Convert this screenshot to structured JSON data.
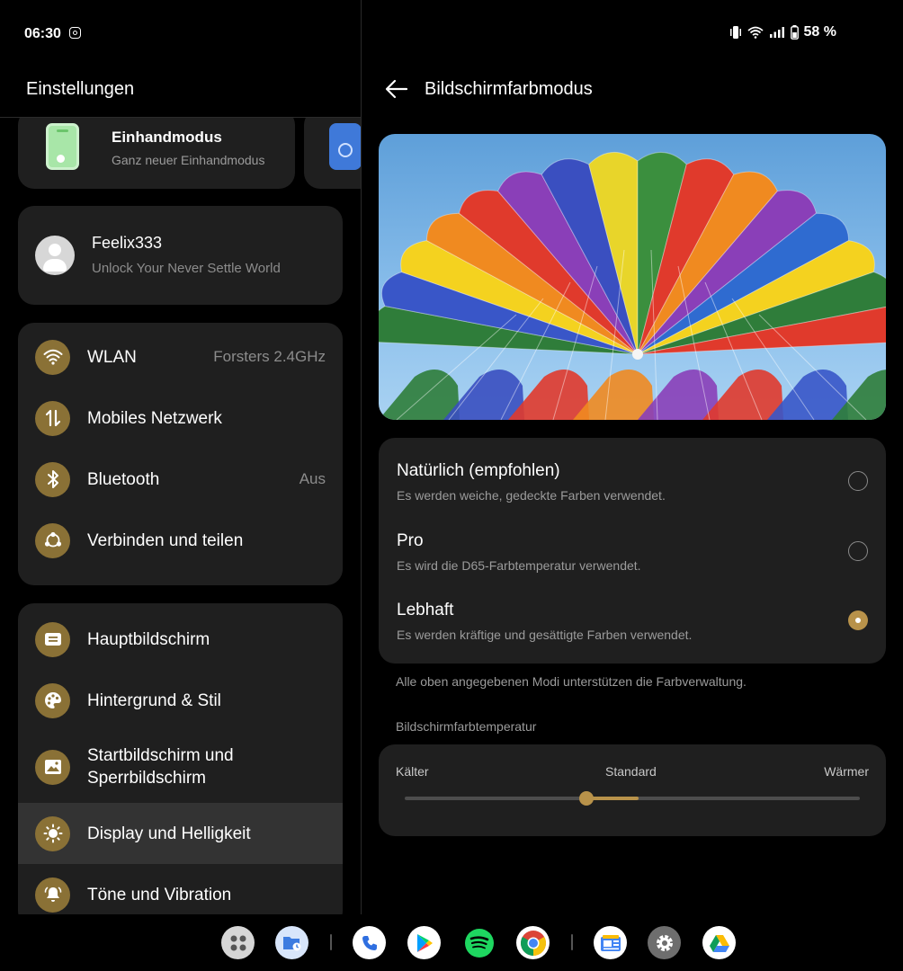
{
  "status": {
    "time": "06:30",
    "notification_icon": "instagram-icon",
    "battery_label": "58 %"
  },
  "left": {
    "title": "Einstellungen",
    "one_hand": {
      "title": "Einhandmodus",
      "subtitle": "Ganz neuer Einhandmodus"
    },
    "account": {
      "name": "Feelix333",
      "subtitle": "Unlock Your Never Settle World"
    },
    "connectivity": [
      {
        "label": "WLAN",
        "value": "Forsters 2.4GHz",
        "icon": "wifi-icon"
      },
      {
        "label": "Mobiles Netzwerk",
        "value": "",
        "icon": "mobile-data-icon"
      },
      {
        "label": "Bluetooth",
        "value": "Aus",
        "icon": "bluetooth-icon"
      },
      {
        "label": "Verbinden und teilen",
        "value": "",
        "icon": "share-icon"
      }
    ],
    "display": [
      {
        "label": "Hauptbildschirm",
        "icon": "home-screen-icon"
      },
      {
        "label": "Hintergrund & Stil",
        "icon": "palette-icon"
      },
      {
        "label": "Startbildschirm und Sperrbildschirm",
        "icon": "wallpaper-icon"
      },
      {
        "label": "Display und Helligkeit",
        "icon": "brightness-icon",
        "active": true
      },
      {
        "label": "Töne und Vibration",
        "icon": "bell-icon"
      }
    ]
  },
  "right": {
    "title": "Bildschirmfarbmodus",
    "hero_image": "parachute-rainbow-photo",
    "modes": [
      {
        "title": "Natürlich (empfohlen)",
        "subtitle": "Es werden weiche, gedeckte Farben verwendet.",
        "selected": false
      },
      {
        "title": "Pro",
        "subtitle": "Es wird die D65-Farbtemperatur verwendet.",
        "selected": false
      },
      {
        "title": "Lebhaft",
        "subtitle": "Es werden kräftige und gesättigte Farben verwendet.",
        "selected": true
      }
    ],
    "note": "Alle oben angegebenen Modi unterstützen die Farbverwaltung.",
    "temperature": {
      "section_label": "Bildschirmfarbtemperatur",
      "left_label": "Kälter",
      "center_label": "Standard",
      "right_label": "Wärmer",
      "value_fraction": 0.4
    }
  },
  "dock": [
    {
      "name": "app-drawer-icon"
    },
    {
      "name": "files-icon"
    },
    {
      "name": "phone-icon"
    },
    {
      "name": "play-store-icon"
    },
    {
      "name": "spotify-icon"
    },
    {
      "name": "chrome-icon"
    },
    {
      "name": "news-icon"
    },
    {
      "name": "settings-icon"
    },
    {
      "name": "drive-icon"
    }
  ],
  "colors": {
    "accent": "#b8924a",
    "icon_bg": "#8a7136",
    "card_bg": "#1f1f1f",
    "active_row": "#333333"
  }
}
